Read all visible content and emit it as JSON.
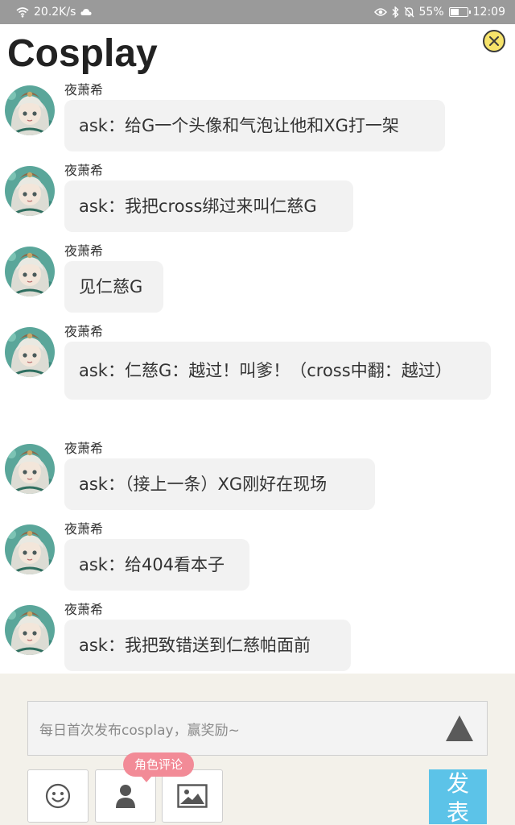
{
  "status_bar": {
    "speed": "20.2K/s",
    "battery": "55%",
    "battery_fraction": 0.55,
    "time": "12:09",
    "icons": [
      "wifi-icon",
      "cloud-icon",
      "eye-icon",
      "bluetooth-icon",
      "mute-bell-icon",
      "battery-icon"
    ]
  },
  "header": {
    "title": "Cosplay",
    "close_icon": "close-icon"
  },
  "messages": [
    {
      "sender": "夜萧希",
      "text": "ask：给G一个头像和气泡让他和XG打一架"
    },
    {
      "sender": "夜萧希",
      "text": "ask：我把cross绑过来叫仁慈G"
    },
    {
      "sender": "夜萧希",
      "text": "见仁慈G"
    },
    {
      "sender": "夜萧希",
      "text": "ask：仁慈G：越过！叫爹！（cross中翻：越过）"
    },
    {
      "sender": "夜萧希",
      "text": "ask：（接上一条）XG刚好在现场"
    },
    {
      "sender": "夜萧希",
      "text": "ask：给404看本子"
    },
    {
      "sender": "夜萧希",
      "text": "ask：我把致错送到仁慈帕面前"
    }
  ],
  "composer": {
    "placeholder": "每日首次发布cosplay，赢奖励~",
    "tooltip": "角色评论",
    "post_label": "发表",
    "colors": {
      "post": "#5cc3e8",
      "tooltip": "#f28b97",
      "background": "#f3f1ea"
    },
    "tools": [
      "smiley-icon",
      "person-icon",
      "image-icon"
    ]
  }
}
